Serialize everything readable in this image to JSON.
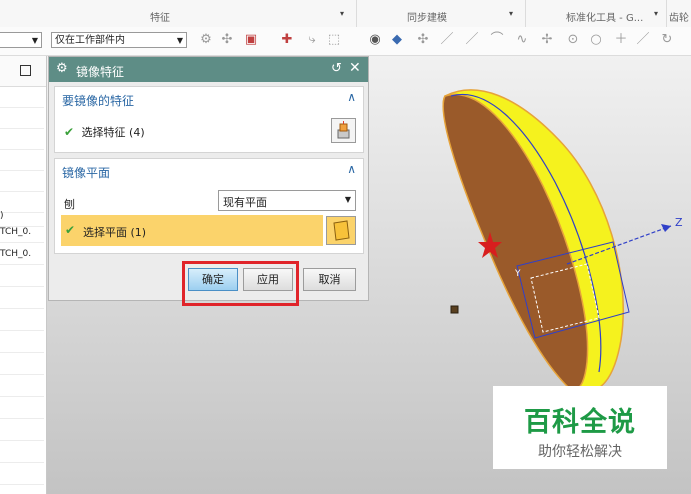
{
  "ribbon": {
    "groups": [
      {
        "label": "特征",
        "dropdown": "▾"
      },
      {
        "label": "同步建模",
        "dropdown": "▾"
      },
      {
        "label": "标准化工具 - G...",
        "dropdown": "▾"
      },
      {
        "label": "齿轮"
      }
    ]
  },
  "toolbar": {
    "filter_value": "",
    "scope_value": "仅在工作部件内"
  },
  "left_panel": {
    "rows": [
      ")",
      "TCH_0.",
      "TCH_0."
    ]
  },
  "dialog": {
    "title": "镜像特征",
    "icon": "gear-icon",
    "features_section": {
      "title": "要镜像的特征",
      "select_label": "选择特征 (4)"
    },
    "plane_section": {
      "title": "镜像平面",
      "plane_label": "刨",
      "plane_option": "现有平面",
      "select_label": "选择平面 (1)"
    },
    "buttons": {
      "ok": "确定",
      "apply": "应用",
      "cancel": "取消"
    }
  },
  "viewport": {
    "axis_z": "Z",
    "axis_y": "Y"
  },
  "watermark": {
    "title": "百科全说",
    "subtitle": "助你轻松解决"
  },
  "colors": {
    "dialog_title_bg": "#5e8d86",
    "section_title": "#2a67a4",
    "highlight_row": "#fbd36b",
    "model_yellow": "#f5f21e",
    "model_face": "#9a5a2a",
    "highlight_box": "#e0242a",
    "axis_blue": "#3040c8"
  }
}
